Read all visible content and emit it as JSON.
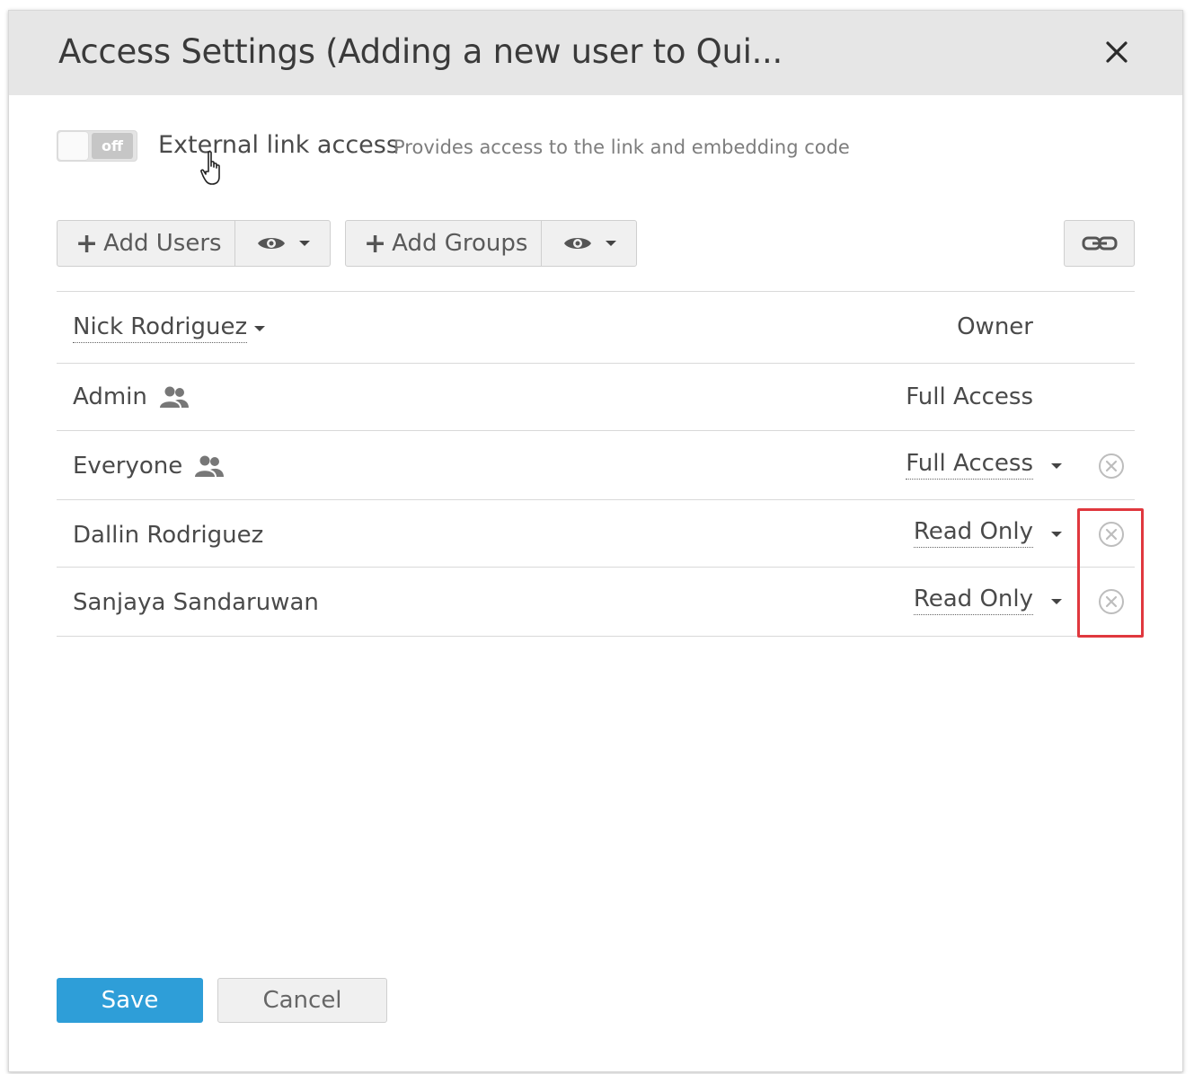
{
  "dialog": {
    "title": "Access Settings (Adding a new user to Qui...",
    "close_icon": "close-icon"
  },
  "external_link": {
    "toggle_state": "off",
    "label": "External link access",
    "description": "Provides access to the link and embedding code"
  },
  "toolbar": {
    "add_users_label": "Add Users",
    "add_groups_label": "Add Groups",
    "view_icon": "eye-icon",
    "link_icon": "link-icon"
  },
  "access_list": {
    "rows": [
      {
        "name": "Nick Rodriguez",
        "name_dropdown": true,
        "group": false,
        "permission": "Owner",
        "perm_dropdown": false,
        "removable": false
      },
      {
        "name": "Admin",
        "name_dropdown": false,
        "group": true,
        "permission": "Full Access",
        "perm_dropdown": false,
        "removable": false
      },
      {
        "name": "Everyone",
        "name_dropdown": false,
        "group": true,
        "permission": "Full Access",
        "perm_dropdown": true,
        "removable": true
      },
      {
        "name": "Dallin Rodriguez",
        "name_dropdown": false,
        "group": false,
        "permission": "Read Only",
        "perm_dropdown": true,
        "removable": true
      },
      {
        "name": "Sanjaya Sandaruwan",
        "name_dropdown": false,
        "group": false,
        "permission": "Read Only",
        "perm_dropdown": true,
        "removable": true
      }
    ]
  },
  "footer": {
    "save_label": "Save",
    "cancel_label": "Cancel"
  },
  "colors": {
    "primary": "#2e9ed8",
    "highlight": "#e0383e",
    "header_bg": "#e6e6e6"
  }
}
